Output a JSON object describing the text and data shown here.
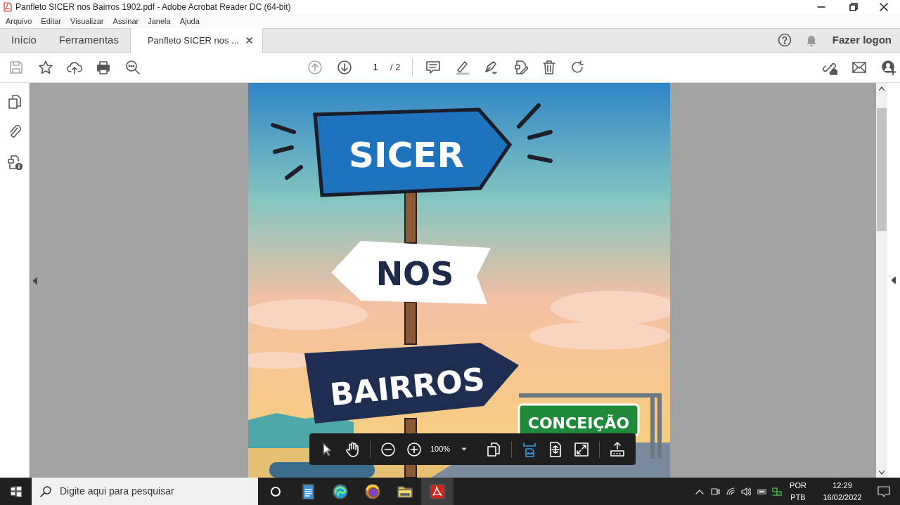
{
  "window": {
    "title": "Panfleto SICER nos Bairros 1902.pdf - Adobe Acrobat Reader DC (64-bit)"
  },
  "menu": [
    "Arquivo",
    "Editar",
    "Visualizar",
    "Assinar",
    "Janela",
    "Ajuda"
  ],
  "tabs": [
    {
      "label": "Início",
      "selected": false
    },
    {
      "label": "Ferramentas",
      "selected": false
    },
    {
      "label": "Panfleto SICER nos ...",
      "selected": true
    }
  ],
  "account": {
    "label": "Fazer logon"
  },
  "toolbar": {
    "page": "1",
    "total": "/ 2"
  },
  "document": {
    "signs": [
      "SICER",
      "NOS",
      "BAIRROS",
      "CONCEIÇÃO"
    ]
  },
  "float_toolbar": {
    "zoom": "100%",
    "view_modes": [
      {
        "selected": true
      },
      {
        "selected": false
      },
      {
        "selected": false
      }
    ]
  },
  "taskbar": {
    "search": {
      "placeholder": "Digite aqui para pesquisar"
    },
    "apps": [
      {
        "selected": false
      },
      {
        "selected": false
      },
      {
        "selected": false
      },
      {
        "selected": false
      },
      {
        "selected": true
      }
    ],
    "language": [
      "POR",
      "PTB"
    ],
    "time": "12:29",
    "date": "16/02/2022"
  }
}
